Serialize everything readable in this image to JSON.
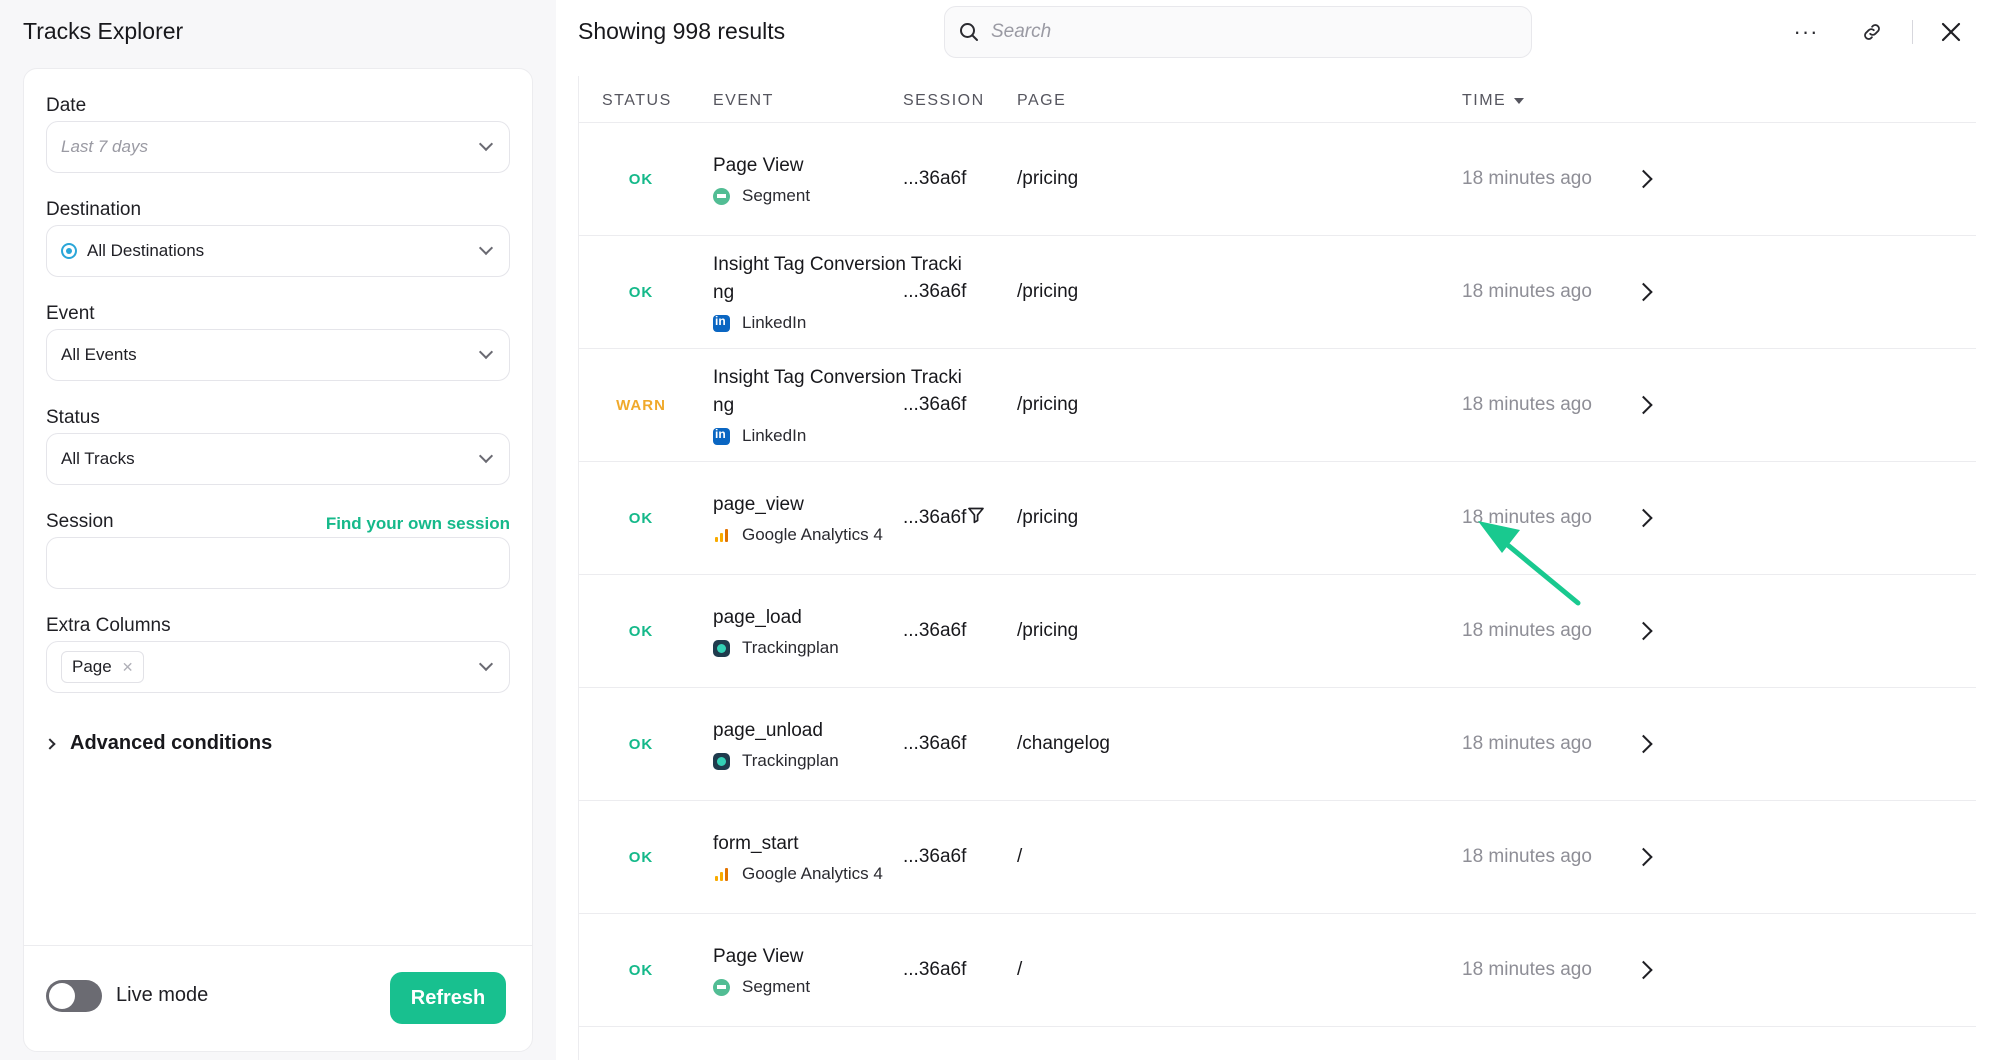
{
  "sidebar": {
    "title": "Tracks Explorer",
    "filters": {
      "date": {
        "label": "Date",
        "placeholder": "Last 7 days"
      },
      "destination": {
        "label": "Destination",
        "value": "All Destinations"
      },
      "event": {
        "label": "Event",
        "value": "All Events"
      },
      "status": {
        "label": "Status",
        "value": "All Tracks"
      },
      "session": {
        "label": "Session",
        "link": "Find your own session",
        "value": ""
      },
      "extra_columns": {
        "label": "Extra Columns",
        "tag": "Page",
        "tag_remove": "✕"
      }
    },
    "advanced_label": "Advanced conditions",
    "live_mode_label": "Live mode",
    "live_mode_on": false,
    "refresh_label": "Refresh"
  },
  "main": {
    "results_label": "Showing 998 results",
    "search_placeholder": "Search",
    "more_icon": "more-horizontal-icon",
    "link_icon": "link-icon",
    "close_icon": "close-icon",
    "columns": {
      "status": "STATUS",
      "event": "EVENT",
      "session": "SESSION",
      "page": "PAGE",
      "time": "TIME"
    },
    "rows": [
      {
        "status": "OK",
        "event": "Page View",
        "destination": "Segment",
        "session": "...36a6f",
        "page": "/pricing",
        "time": "18 minutes ago"
      },
      {
        "status": "OK",
        "event": "Insight Tag Conversion Tracking",
        "destination": "LinkedIn",
        "session": "...36a6f",
        "page": "/pricing",
        "time": "18 minutes ago"
      },
      {
        "status": "WARN",
        "event": "Insight Tag Conversion Tracking",
        "destination": "LinkedIn",
        "session": "...36a6f",
        "page": "/pricing",
        "time": "18 minutes ago"
      },
      {
        "status": "OK",
        "event": "page_view",
        "destination": "Google Analytics 4",
        "session": "...36a6f",
        "page": "/pricing",
        "time": "18 minutes ago"
      },
      {
        "status": "OK",
        "event": "page_load",
        "destination": "Trackingplan",
        "session": "...36a6f",
        "page": "/pricing",
        "time": "18 minutes ago"
      },
      {
        "status": "OK",
        "event": "page_unload",
        "destination": "Trackingplan",
        "session": "...36a6f",
        "page": "/changelog",
        "time": "18 minutes ago"
      },
      {
        "status": "OK",
        "event": "form_start",
        "destination": "Google Analytics 4",
        "session": "...36a6f",
        "page": "/",
        "time": "18 minutes ago"
      },
      {
        "status": "OK",
        "event": "Page View",
        "destination": "Segment",
        "session": "...36a6f",
        "page": "/",
        "time": "18 minutes ago"
      }
    ]
  },
  "colors": {
    "ok": "#15b98a",
    "warn": "#f0a92b",
    "accent": "#18c08f",
    "annotation_arrow": "#19c98f"
  }
}
